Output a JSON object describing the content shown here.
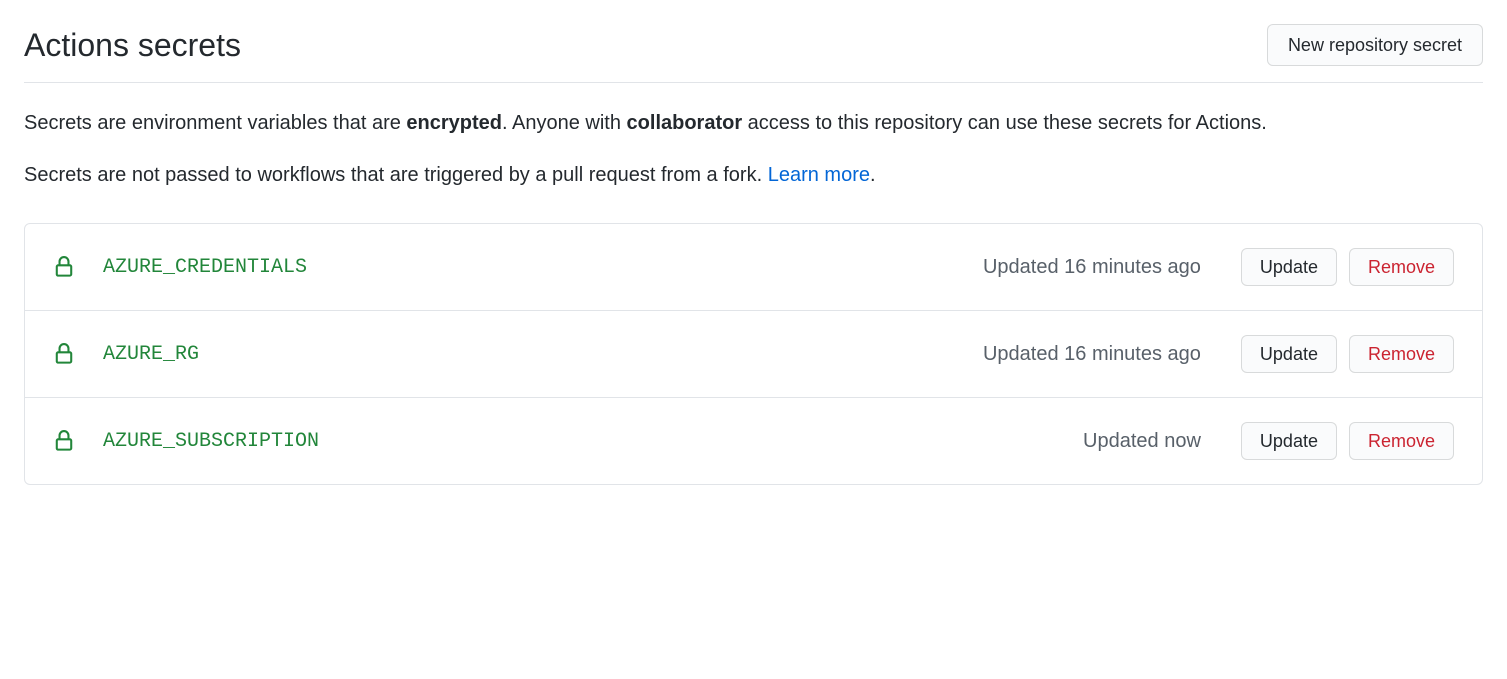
{
  "header": {
    "title": "Actions secrets",
    "new_secret_button": "New repository secret"
  },
  "description": {
    "line1_prefix": "Secrets are environment variables that are ",
    "line1_bold1": "encrypted",
    "line1_mid": ". Anyone with ",
    "line1_bold2": "collaborator",
    "line1_suffix": " access to this repository can use these secrets for Actions.",
    "line2_prefix": "Secrets are not passed to workflows that are triggered by a pull request from a fork. ",
    "line2_link": "Learn more",
    "line2_suffix": "."
  },
  "labels": {
    "update": "Update",
    "remove": "Remove"
  },
  "secrets": [
    {
      "name": "AZURE_CREDENTIALS",
      "updated": "Updated 16 minutes ago"
    },
    {
      "name": "AZURE_RG",
      "updated": "Updated 16 minutes ago"
    },
    {
      "name": "AZURE_SUBSCRIPTION",
      "updated": "Updated now"
    }
  ]
}
